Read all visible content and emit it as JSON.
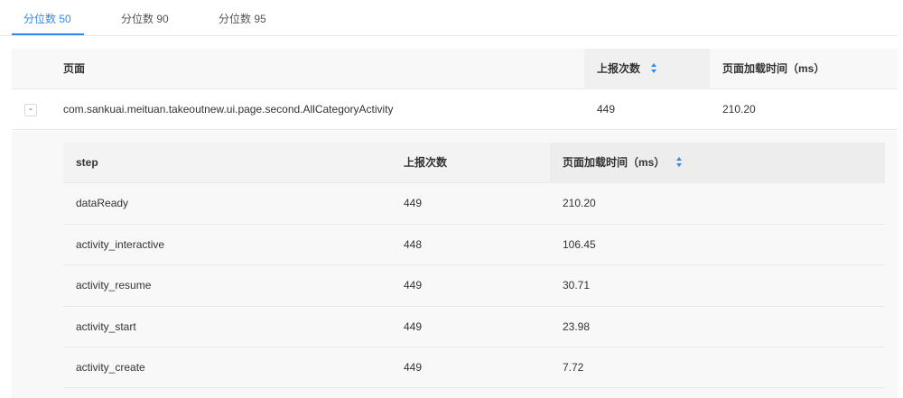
{
  "tabs": [
    {
      "label": "分位数 50",
      "active": true
    },
    {
      "label": "分位数 90",
      "active": false
    },
    {
      "label": "分位数 95",
      "active": false
    }
  ],
  "outer_table": {
    "columns": [
      "页面",
      "上报次数",
      "页面加载时间（ms）"
    ],
    "rows": [
      {
        "expand_symbol": "-",
        "page": "com.sankuai.meituan.takeoutnew.ui.page.second.AllCategoryActivity",
        "count": "449",
        "load_time": "210.20"
      }
    ]
  },
  "inner_table": {
    "columns": [
      "step",
      "上报次数",
      "页面加载时间（ms）"
    ],
    "rows": [
      {
        "step": "dataReady",
        "count": "449",
        "load_time": "210.20"
      },
      {
        "step": "activity_interactive",
        "count": "448",
        "load_time": "106.45"
      },
      {
        "step": "activity_resume",
        "count": "449",
        "load_time": "30.71"
      },
      {
        "step": "activity_start",
        "count": "449",
        "load_time": "23.98"
      },
      {
        "step": "activity_create",
        "count": "449",
        "load_time": "7.72"
      }
    ]
  },
  "colors": {
    "accent": "#2d8cf0",
    "header_bg": "#f8f8f9",
    "border": "#e8e8e8"
  }
}
